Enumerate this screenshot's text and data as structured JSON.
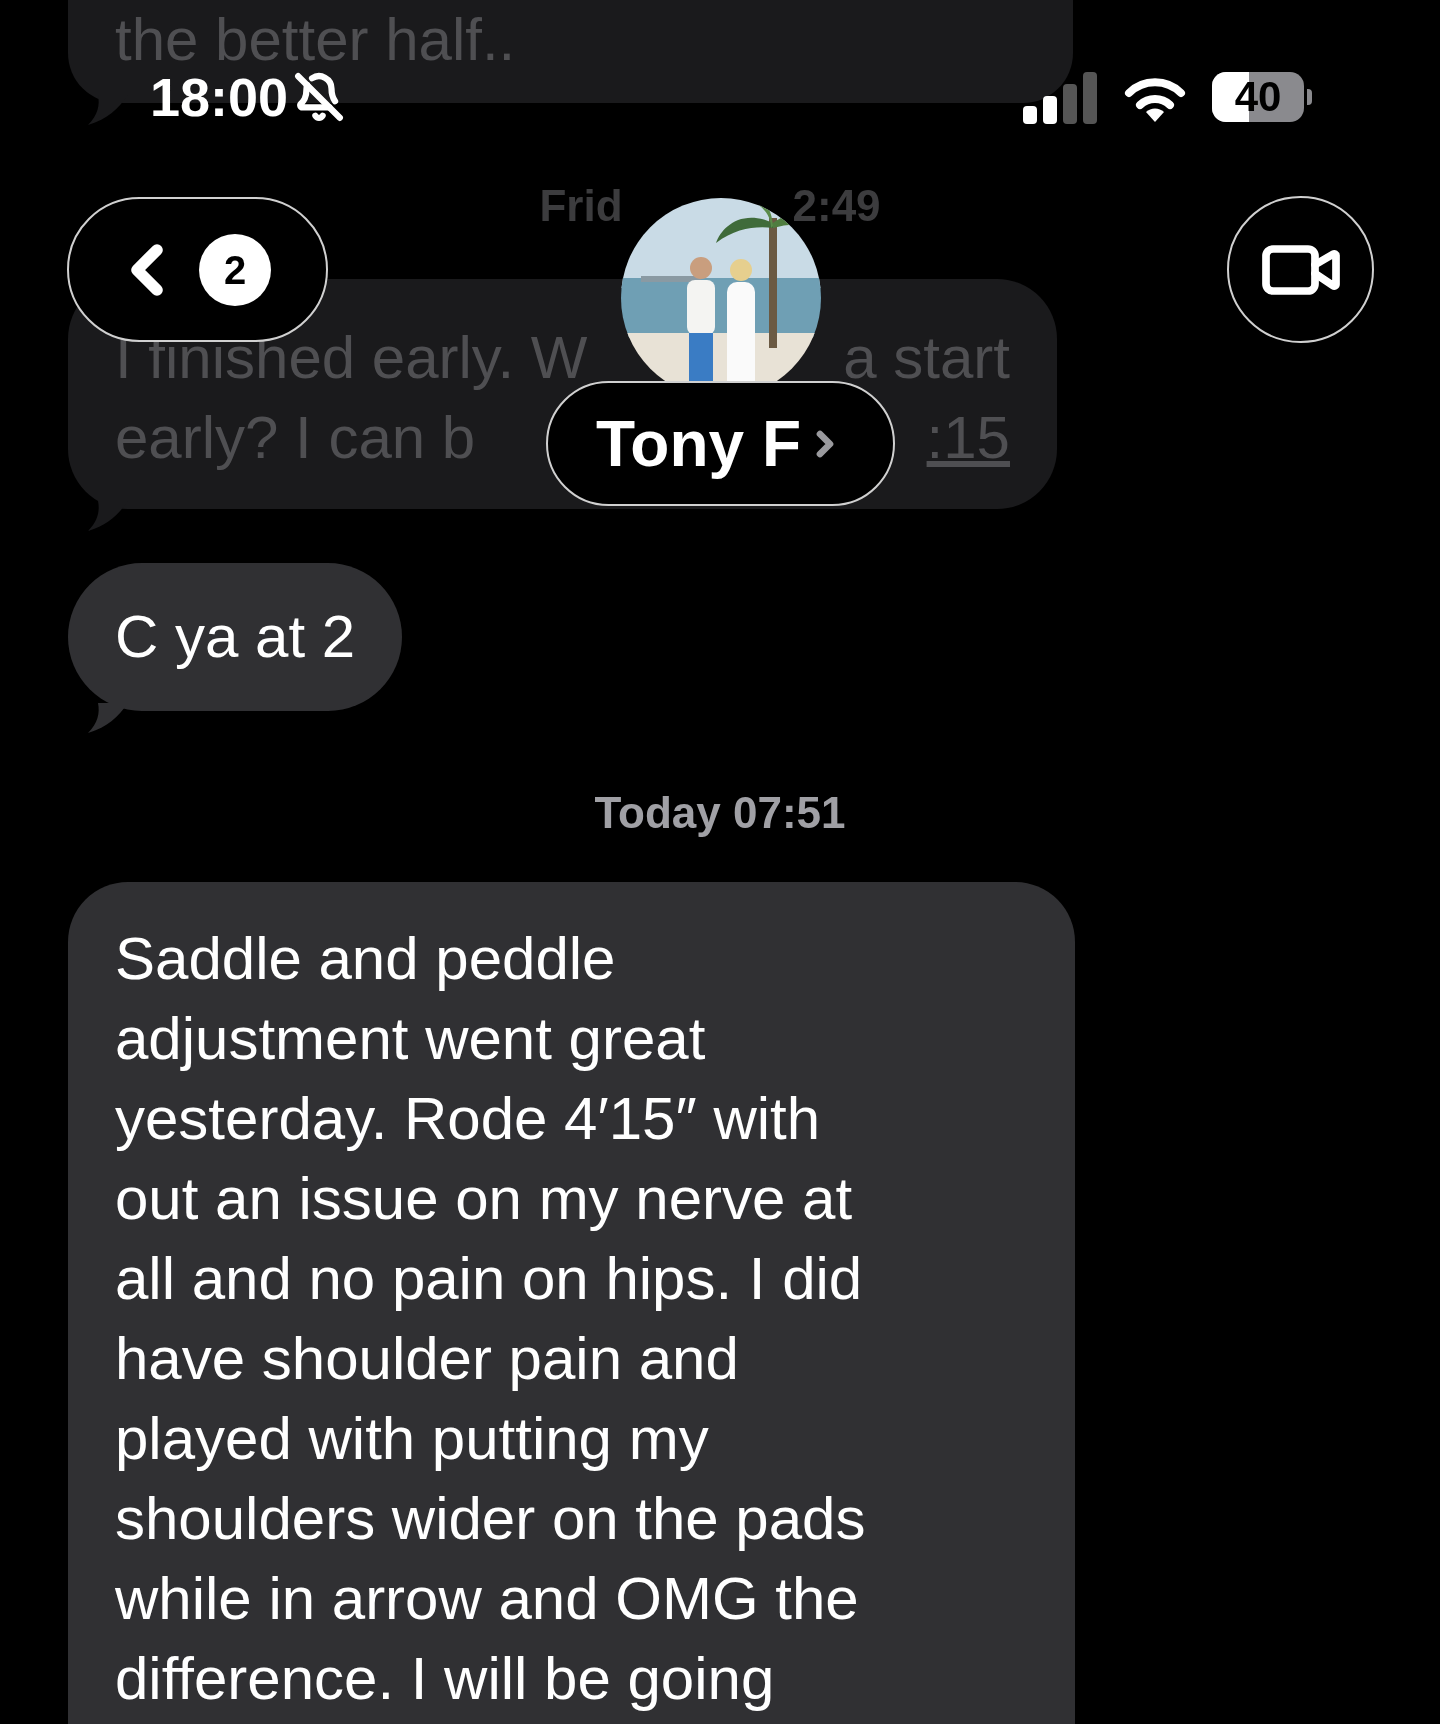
{
  "status_bar": {
    "time": "18:00",
    "silent": true,
    "battery": "40"
  },
  "header": {
    "back_badge": "2",
    "contact_name": "Tony F"
  },
  "conversation": [
    {
      "kind": "bubble",
      "faded": true,
      "lines": [
        [
          "the better half.."
        ]
      ]
    },
    {
      "kind": "timestamp",
      "faded": true,
      "parts": [
        "Frid",
        "2:49"
      ]
    },
    {
      "kind": "bubble",
      "faded": true,
      "lines": [
        [
          "I finished early. W",
          "a start"
        ],
        [
          "early?  I can b",
          ":15"
        ]
      ]
    },
    {
      "kind": "bubble",
      "faded": false,
      "lines": [
        [
          "C ya at 2"
        ]
      ]
    },
    {
      "kind": "timestamp",
      "faded": false,
      "parts": [
        "Today 07:51"
      ]
    },
    {
      "kind": "paragraph",
      "faded": false,
      "lines": [
        "Saddle and peddle",
        "adjustment went great",
        "yesterday. Rode 4′15″ with",
        "out an issue on my nerve at",
        "all and no pain on hips. I did",
        "have shoulder pain and",
        "played with putting my",
        "shoulders wider on the pads",
        "while in arrow and OMG the",
        "difference. I will be going"
      ]
    }
  ]
}
